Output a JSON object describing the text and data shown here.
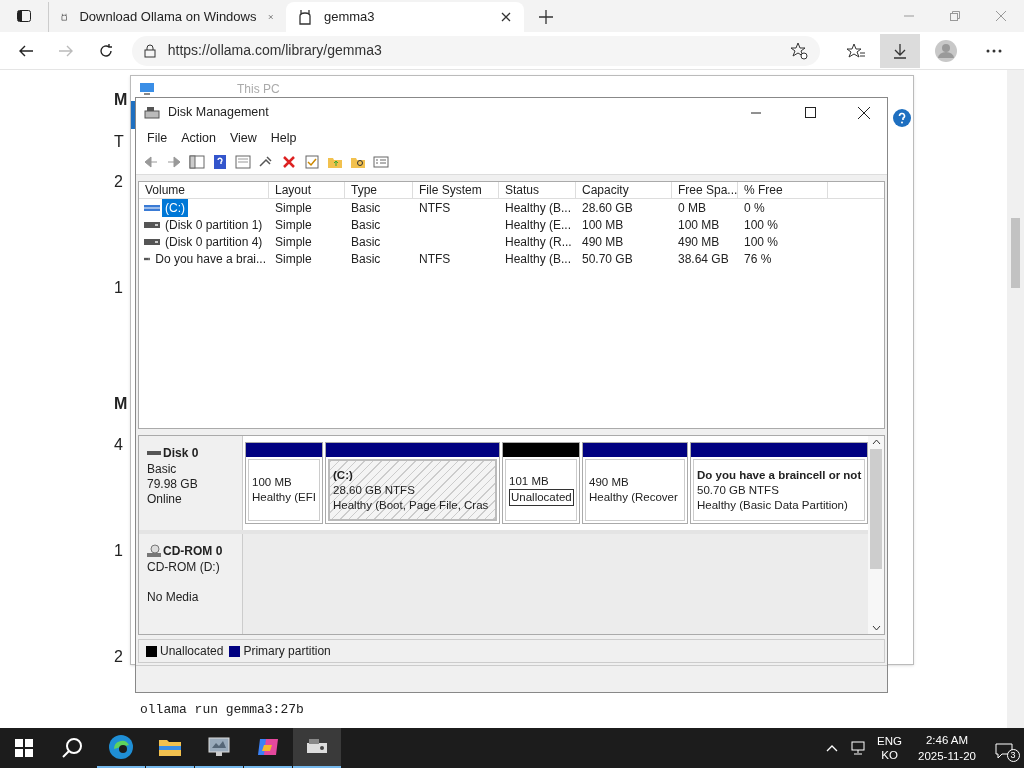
{
  "browser": {
    "tabs": [
      {
        "title": "Download Ollama on Windows",
        "selected": false
      },
      {
        "title": "gemma3",
        "selected": true
      }
    ],
    "url": "https://ollama.com/library/gemma3"
  },
  "page": {
    "fragments": [
      "M",
      "T",
      "2",
      "1",
      "M",
      "4",
      "1",
      "2"
    ],
    "command": "ollama run gemma3:27b"
  },
  "explorer_window": {
    "title": "This PC"
  },
  "disk_management": {
    "title": "Disk Management",
    "menu": [
      "File",
      "Action",
      "View",
      "Help"
    ],
    "columns": [
      "Volume",
      "Layout",
      "Type",
      "File System",
      "Status",
      "Capacity",
      "Free Spa...",
      "% Free"
    ],
    "rows": [
      {
        "cells": [
          "(C:)",
          "Simple",
          "Basic",
          "NTFS",
          "Healthy (B...",
          "28.60 GB",
          "0 MB",
          "0 %"
        ],
        "selected": true,
        "kind": "striped"
      },
      {
        "cells": [
          "(Disk 0 partition 1)",
          "Simple",
          "Basic",
          "",
          "Healthy (E...",
          "100 MB",
          "100 MB",
          "100 %"
        ],
        "selected": false,
        "kind": "plain"
      },
      {
        "cells": [
          "(Disk 0 partition 4)",
          "Simple",
          "Basic",
          "",
          "Healthy (R...",
          "490 MB",
          "490 MB",
          "100 %"
        ],
        "selected": false,
        "kind": "plain"
      },
      {
        "cells": [
          "Do you have a brai...",
          "Simple",
          "Basic",
          "NTFS",
          "Healthy (B...",
          "50.70 GB",
          "38.64 GB",
          "76 %"
        ],
        "selected": false,
        "kind": "plain"
      }
    ],
    "disks": [
      {
        "kind": "disk",
        "name": "Disk 0",
        "lines": [
          "Basic",
          "79.98 GB",
          "Online"
        ],
        "partitions": [
          {
            "kind": "primary",
            "selected": false,
            "focused": false,
            "lines": [
              "100 MB",
              "Healthy (EFI"
            ]
          },
          {
            "kind": "primary",
            "selected": true,
            "focused": false,
            "name": "(C:)",
            "lines": [
              "28.60 GB NTFS",
              "Healthy (Boot, Page File, Cras"
            ]
          },
          {
            "kind": "unallocated",
            "selected": false,
            "focused": true,
            "lines": [
              "101 MB",
              "Unallocated"
            ]
          },
          {
            "kind": "primary",
            "selected": false,
            "focused": false,
            "lines": [
              "490 MB",
              "Healthy (Recover"
            ]
          },
          {
            "kind": "primary",
            "selected": false,
            "focused": false,
            "name": "Do you have a braincell or not",
            "lines": [
              "50.70 GB NTFS",
              "Healthy (Basic Data Partition)"
            ]
          }
        ]
      },
      {
        "kind": "cdrom",
        "name": "CD-ROM 0",
        "lines": [
          "CD-ROM (D:)",
          "No Media"
        ]
      }
    ],
    "legend": [
      {
        "label": "Unallocated",
        "color": "#000000"
      },
      {
        "label": "Primary partition",
        "color": "#000080"
      }
    ]
  },
  "taskbar": {
    "apps": [
      {
        "kind": "edge",
        "open": true,
        "active": false
      },
      {
        "kind": "files",
        "open": true,
        "active": false
      },
      {
        "kind": "monitor",
        "open": true,
        "active": false
      },
      {
        "kind": "copilot",
        "open": true,
        "active": false
      },
      {
        "kind": "disk",
        "open": true,
        "active": true
      }
    ],
    "language": "ENG",
    "layout": "KO",
    "time": "2:46 AM",
    "date": "2025-11-20",
    "notifications": "3"
  }
}
